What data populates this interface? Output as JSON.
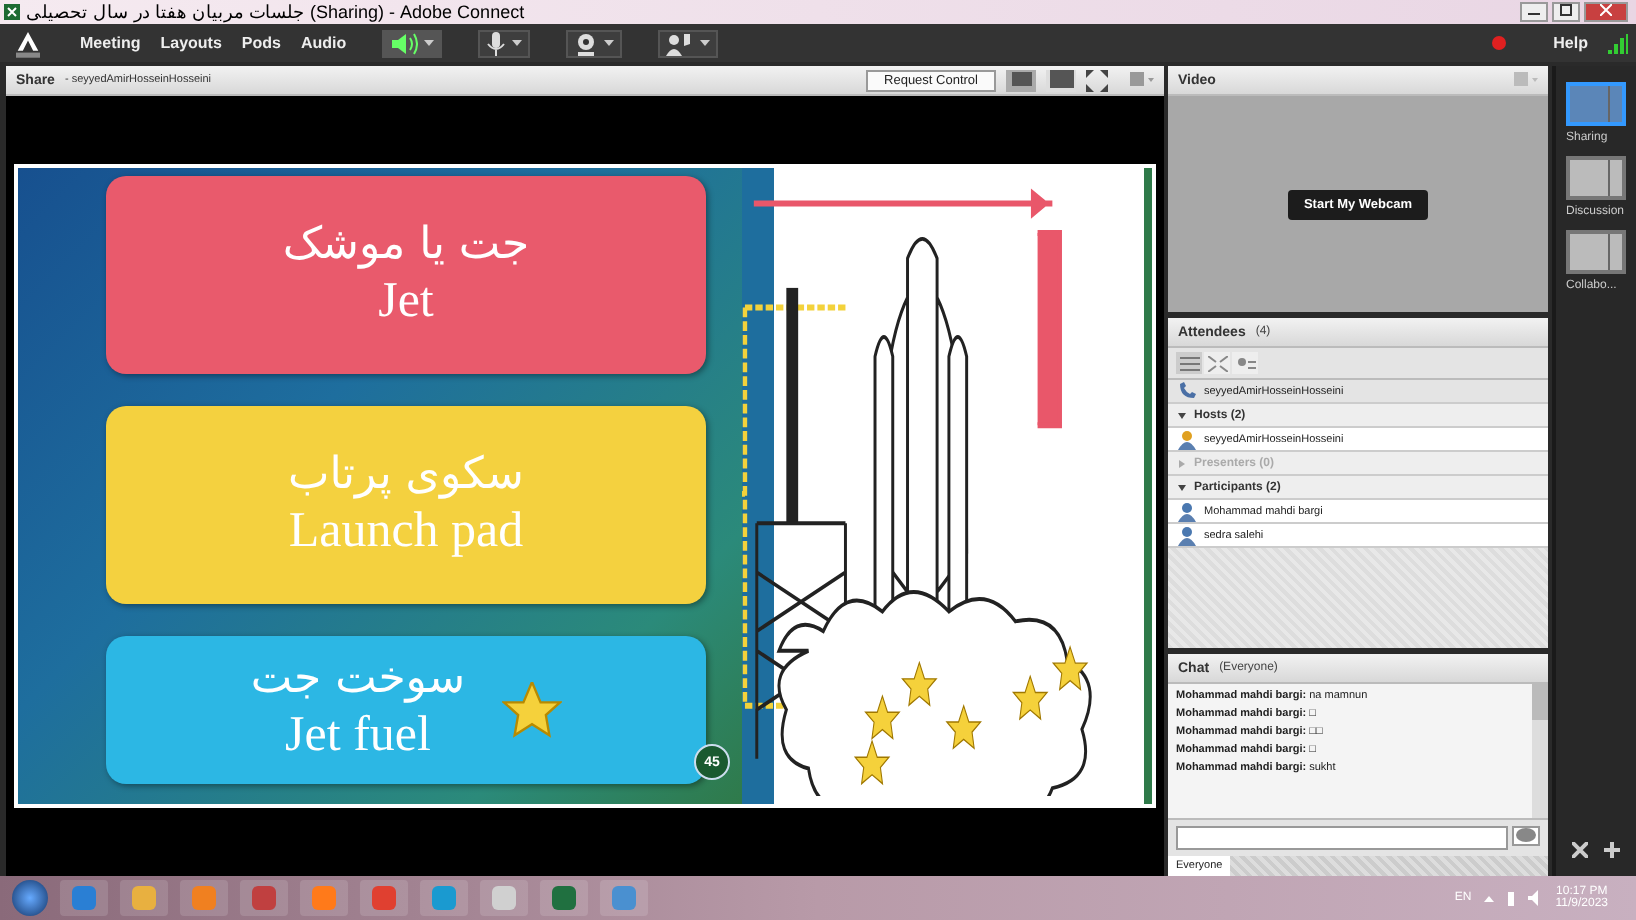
{
  "window": {
    "title": "جلسات مربیان هفتا در سال تحصیلی (Sharing) - Adobe Connect"
  },
  "menu": [
    "Meeting",
    "Layouts",
    "Pods",
    "Audio"
  ],
  "help": "Help",
  "share_pod": {
    "title": "Share",
    "presenter": "- seyyedAmirHosseinHosseini",
    "request_button": "Request Control"
  },
  "slide": {
    "cards": [
      {
        "persian": "جت یا موشک",
        "english": "Jet",
        "color": "#e95a6c",
        "star": false
      },
      {
        "persian": "سکوی پرتاب",
        "english": "Launch pad",
        "color": "#f4d13f",
        "star": false
      },
      {
        "persian": "سوخت جت",
        "english": "Jet fuel",
        "color": "#2cb7e4",
        "star": true
      }
    ],
    "page_number": "45"
  },
  "video_pod": {
    "title": "Video",
    "button": "Start My Webcam"
  },
  "attendees": {
    "title": "Attendees",
    "count": "(4)",
    "me": "seyyedAmirHosseinHosseini",
    "groups": [
      {
        "label": "Hosts (2)",
        "expanded": true,
        "people": [
          "seyyedAmirHosseinHosseini"
        ]
      },
      {
        "label": "Presenters (0)",
        "expanded": false
      },
      {
        "label": "Participants (2)",
        "expanded": true,
        "people": [
          "Mohammad mahdi bargi",
          "sedra salehi"
        ]
      }
    ]
  },
  "chat": {
    "title": "Chat",
    "scope": "(Everyone)",
    "messages": [
      {
        "sender": "Mohammad mahdi bargi:",
        "text": "na mamnun"
      },
      {
        "sender": "Mohammad mahdi bargi:",
        "text": "□"
      },
      {
        "sender": "Mohammad mahdi bargi:",
        "text": "□□"
      },
      {
        "sender": "Mohammad mahdi bargi:",
        "text": "□"
      },
      {
        "sender": "Mohammad mahdi bargi:",
        "text": "sukht"
      }
    ],
    "tab": "Everyone"
  },
  "layouts": [
    {
      "label": "Sharing",
      "selected": true
    },
    {
      "label": "Discussion",
      "selected": false
    },
    {
      "label": "Collabo...",
      "selected": false
    }
  ],
  "taskbar": {
    "language": "EN",
    "time": "10:17 PM",
    "date": "11/9/2023"
  }
}
